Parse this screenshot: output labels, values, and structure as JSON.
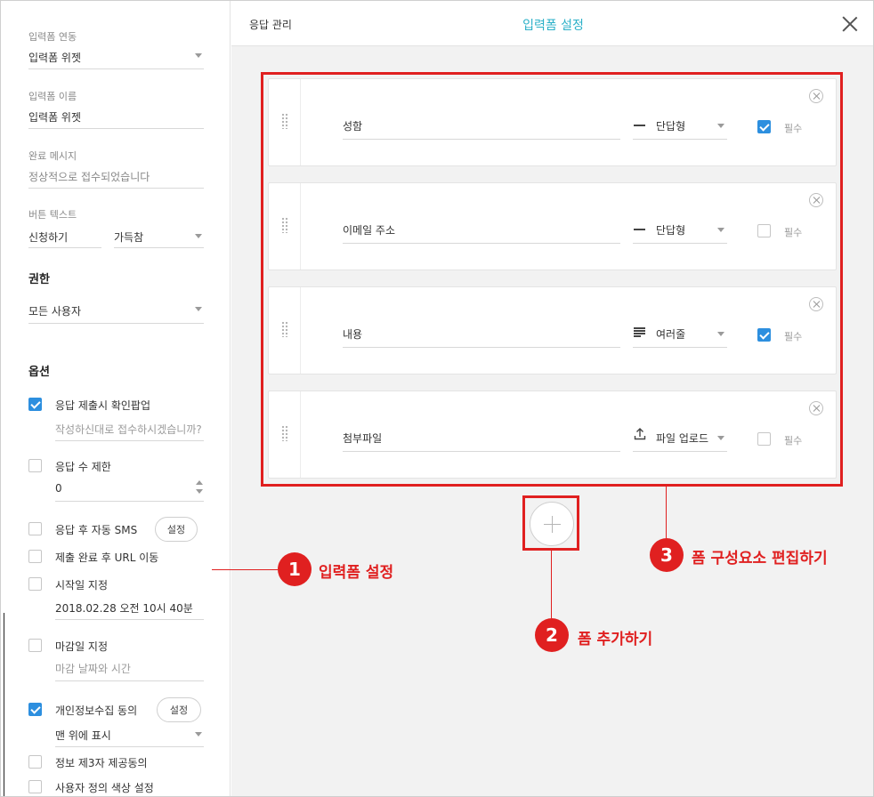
{
  "left_panel": {
    "form_link": {
      "label": "입력폼 연동",
      "value": "입력폼 위젯"
    },
    "form_name": {
      "label": "입력폼 이름",
      "value": "입력폼 위젯"
    },
    "complete_message": {
      "label": "완료 메시지",
      "value": "정상적으로 접수되었습니다"
    },
    "button_text": {
      "label": "버튼 텍스트",
      "value": "신청하기",
      "width_value": "가득참"
    },
    "permission": {
      "title": "권한",
      "value": "모든 사용자"
    },
    "options": {
      "title": "옵션",
      "items": [
        {
          "label": "응답 제출시 확인팝업",
          "checked": true,
          "sub": "작성하신대로 접수하시겠습니까?"
        },
        {
          "label": "응답 수 제한",
          "checked": false,
          "sub": "0"
        },
        {
          "label": "응답 후 자동 SMS",
          "checked": false,
          "button": "설정"
        },
        {
          "label": "제출 완료 후 URL 이동",
          "checked": false
        },
        {
          "label": "시작일 지정",
          "checked": false,
          "sub": "2018.02.28 오전 10시 40분"
        },
        {
          "label": "마감일 지정",
          "checked": false,
          "sub": "마감 날짜와 시간"
        },
        {
          "label": "개인정보수집 동의",
          "checked": true,
          "button": "설정",
          "sub": "맨 위에 표시"
        },
        {
          "label": "정보 제3자 제공동의",
          "checked": false
        },
        {
          "label": "사용자 정의 색상 설정",
          "checked": false
        }
      ]
    }
  },
  "header": {
    "tab_response": "응답 관리",
    "title": "입력폼 설정"
  },
  "form_items": [
    {
      "question": "성함",
      "type": "단답형",
      "type_icon": "short-answer-icon",
      "required": true,
      "required_label": "필수"
    },
    {
      "question": "이메일 주소",
      "type": "단답형",
      "type_icon": "short-answer-icon",
      "required": false,
      "required_label": "필수"
    },
    {
      "question": "내용",
      "type": "여러줄",
      "type_icon": "paragraph-icon",
      "required": true,
      "required_label": "필수"
    },
    {
      "question": "첨부파일",
      "type": "파일 업로드",
      "type_icon": "upload-icon",
      "required": false,
      "required_label": "필수"
    }
  ],
  "annotations": [
    {
      "number": "1",
      "text": "입력폼 설정"
    },
    {
      "number": "2",
      "text": "폼 추가하기"
    },
    {
      "number": "3",
      "text": "폼 구성요소 편집하기"
    }
  ],
  "colors": {
    "accent": "#2bb0c8",
    "checkbox": "#2d8fdf",
    "annotation": "#e02020"
  }
}
